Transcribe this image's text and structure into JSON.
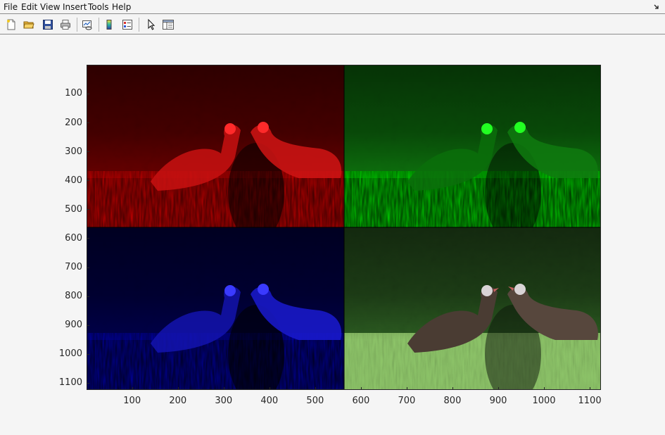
{
  "menu": {
    "items": [
      "File",
      "Edit",
      "View",
      "Insert",
      "Tools",
      "Help"
    ],
    "dock_icon": "dock-arrow-icon"
  },
  "toolbar": {
    "buttons": [
      {
        "name": "new-figure-button",
        "icon": "new-file-icon"
      },
      {
        "name": "open-file-button",
        "icon": "open-folder-icon"
      },
      {
        "name": "save-figure-button",
        "icon": "save-icon"
      },
      {
        "name": "print-figure-button",
        "icon": "printer-icon"
      },
      {
        "name": "link-plot-button",
        "icon": "link-plot-icon"
      },
      {
        "name": "insert-colorbar-button",
        "icon": "colorbar-icon"
      },
      {
        "name": "insert-legend-button",
        "icon": "legend-icon"
      },
      {
        "name": "edit-plot-button",
        "icon": "pointer-icon"
      },
      {
        "name": "plot-browser-button",
        "icon": "plot-tools-icon"
      }
    ]
  },
  "axes": {
    "y_ticks": [
      "100",
      "200",
      "300",
      "400",
      "500",
      "600",
      "700",
      "800",
      "900",
      "1000",
      "1100"
    ],
    "x_ticks": [
      "100",
      "200",
      "300",
      "400",
      "500",
      "600",
      "700",
      "800",
      "900",
      "1000",
      "1100"
    ],
    "x_range": [
      0.5,
      1124.5
    ],
    "y_range": [
      0.5,
      1124.5
    ],
    "y_direction": "reverse"
  },
  "image": {
    "panels": [
      {
        "name": "red-channel-panel",
        "tint": "#ff0000",
        "position": "top-left"
      },
      {
        "name": "green-channel-panel",
        "tint": "#00ff00",
        "position": "top-right"
      },
      {
        "name": "blue-channel-panel",
        "tint": "#0000ff",
        "position": "bottom-left"
      },
      {
        "name": "color-composite-panel",
        "tint": "natural",
        "position": "bottom-right"
      }
    ],
    "subject": "two wild turkeys facing each other in green foliage and grass"
  },
  "colors": {
    "window_bg": "#f5f5f5",
    "axis_color": "#262626"
  }
}
